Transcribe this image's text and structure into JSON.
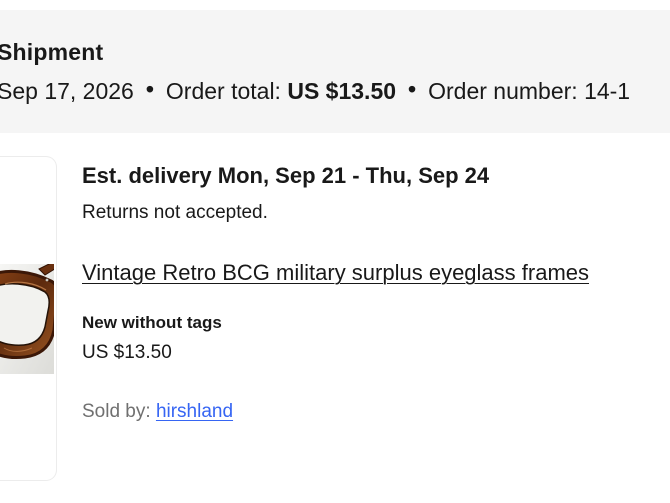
{
  "shipment": {
    "title": "Shipment",
    "order_date": "Sep 17, 2026",
    "separator": "•",
    "order_total_label": "Order total:",
    "order_total_value": "US $13.50",
    "order_number_label": "Order number:",
    "order_number_value": "14-1"
  },
  "item": {
    "delivery": "Est. delivery Mon, Sep 21 - Thu, Sep 24",
    "returns": "Returns not accepted.",
    "title": "Vintage Retro BCG military surplus eyeglass frames",
    "condition": "New without tags",
    "price": "US $13.50",
    "sold_by_label": "Sold by:",
    "seller": "hirshland"
  },
  "colors": {
    "header_background": "#f5f5f5",
    "link": "#3665f3",
    "muted_text": "#707070",
    "frame_tortoise": "#7a3b17"
  },
  "icons": {
    "bullet": "separator-dot"
  }
}
